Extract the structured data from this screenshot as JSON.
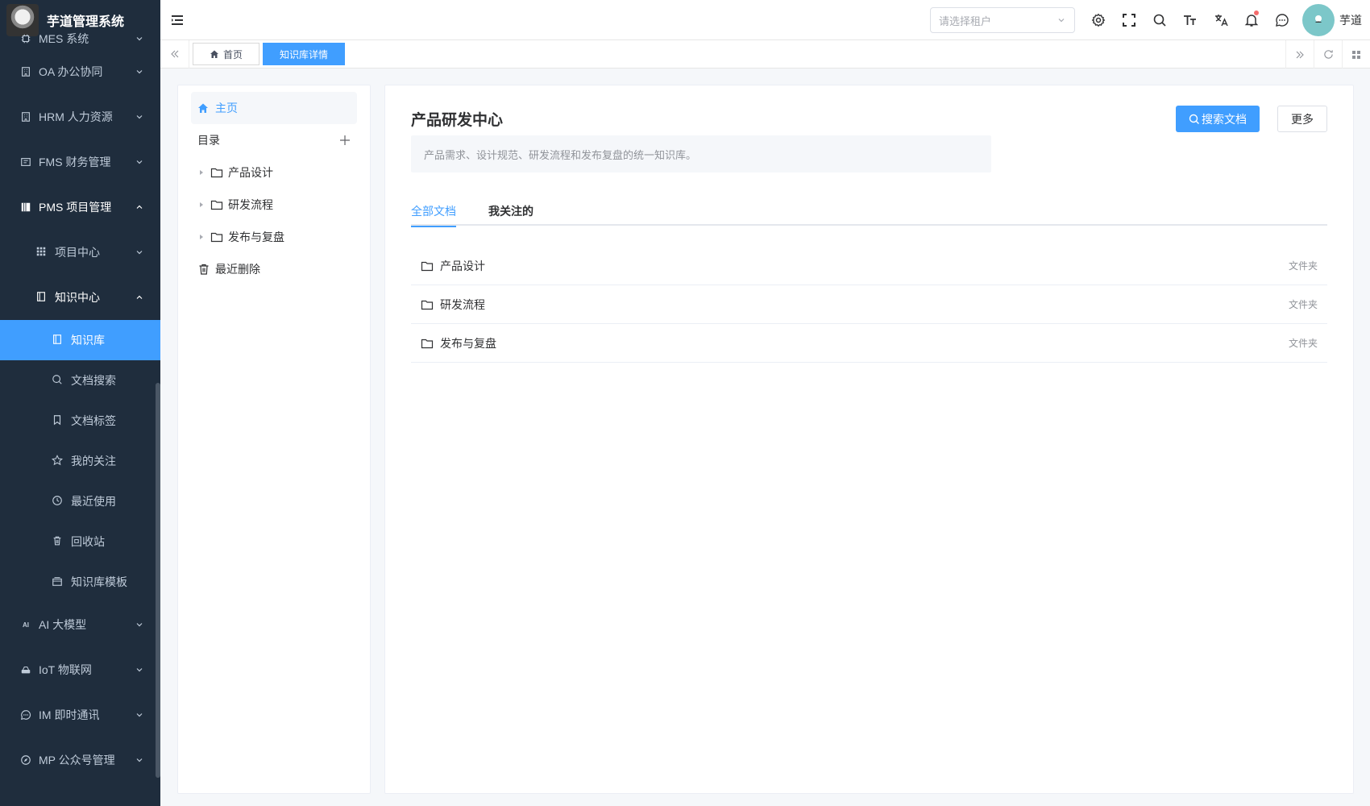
{
  "app": {
    "title": "芋道管理系统"
  },
  "sidebar": {
    "menus": [
      {
        "label": "MES 系统",
        "icon": "cpu-icon"
      },
      {
        "label": "OA 办公协同",
        "icon": "building-icon"
      },
      {
        "label": "HRM 人力资源",
        "icon": "building-icon"
      },
      {
        "label": "FMS 财务管理",
        "icon": "finance-icon"
      },
      {
        "label": "PMS 项目管理",
        "icon": "project-icon"
      }
    ],
    "pms_children": [
      {
        "label": "项目中心"
      },
      {
        "label": "知识中心"
      }
    ],
    "knowledge_children": [
      {
        "label": "知识库"
      },
      {
        "label": "文档搜索"
      },
      {
        "label": "文档标签"
      },
      {
        "label": "我的关注"
      },
      {
        "label": "最近使用"
      },
      {
        "label": "回收站"
      },
      {
        "label": "知识库模板"
      }
    ],
    "menus_after": [
      {
        "label": "AI 大模型",
        "icon_text": "AI"
      },
      {
        "label": "IoT 物联网"
      },
      {
        "label": "IM 即时通讯"
      },
      {
        "label": "MP 公众号管理"
      }
    ]
  },
  "header": {
    "tenant_placeholder": "请选择租户",
    "user_name": "芋道"
  },
  "tags": {
    "items": [
      {
        "label": "首页"
      },
      {
        "label": "知识库详情"
      }
    ]
  },
  "tree": {
    "home_label": "主页",
    "dir_label": "目录",
    "nodes": [
      {
        "label": "产品设计"
      },
      {
        "label": "研发流程"
      },
      {
        "label": "发布与复盘"
      }
    ],
    "trash_label": "最近删除"
  },
  "main": {
    "title": "产品研发中心",
    "description": "产品需求、设计规范、研发流程和发布复盘的统一知识库。",
    "search_button": "搜索文档",
    "more_button": "更多",
    "tabs": [
      {
        "label": "全部文档"
      },
      {
        "label": "我关注的"
      }
    ],
    "docs": [
      {
        "name": "产品设计",
        "type": "文件夹"
      },
      {
        "name": "研发流程",
        "type": "文件夹"
      },
      {
        "name": "发布与复盘",
        "type": "文件夹"
      }
    ]
  },
  "colors": {
    "primary": "#409eff",
    "sidebar_bg": "#1f2d3d",
    "sidebar_text": "#bfcbd9"
  }
}
